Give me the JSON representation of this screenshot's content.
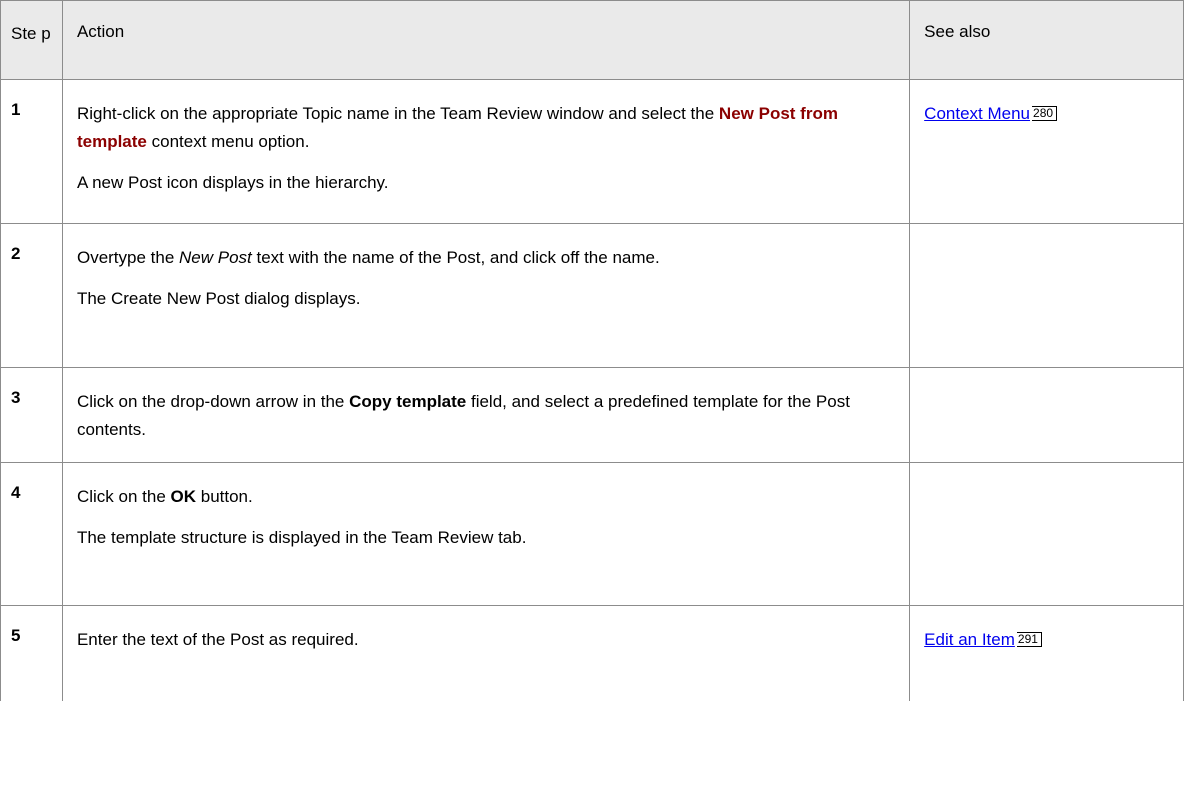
{
  "table": {
    "headers": [
      "Ste p",
      "Action",
      "See also"
    ],
    "rows": [
      {
        "step": "1",
        "p1_a": "Right-click on the appropriate Topic name in the Team Review window and select the ",
        "p1_highlight": "New Post from template",
        "p1_b": " context menu option.",
        "p2": "A new Post icon displays in the hierarchy.",
        "see_link": "Context Menu",
        "see_page": "280"
      },
      {
        "step": "2",
        "p1_a": "Overtype the ",
        "p1_italic": "New Post",
        "p1_b": " text with the name of the Post, and click off the name.",
        "p2": "The Create New Post dialog displays."
      },
      {
        "step": "3",
        "p1_a": "Click on the drop-down arrow in the ",
        "p1_bold": "Copy template",
        "p1_b": " field, and select a predefined template for the Post contents."
      },
      {
        "step": "4",
        "p1_a": "Click on the ",
        "p1_bold": "OK",
        "p1_b": " button.",
        "p2": "The template structure is displayed in the Team Review tab."
      },
      {
        "step": "5",
        "p1": "Enter the text of the Post as required.",
        "see_link": "Edit an Item",
        "see_page": "291"
      }
    ]
  }
}
